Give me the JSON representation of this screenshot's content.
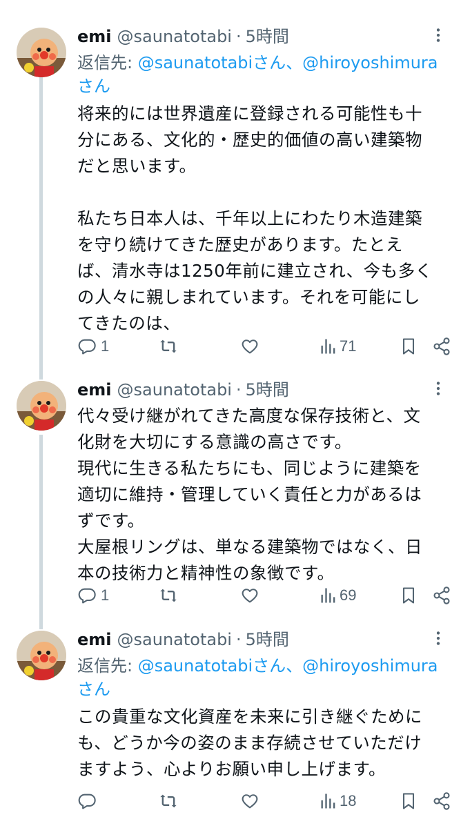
{
  "tweets": [
    {
      "name": "emi",
      "handle": "@saunatotabi",
      "dot": "·",
      "time": "5時間",
      "replying_prefix": "返信先: ",
      "replying_to_1": "@saunatotabiさん",
      "replying_sep": "、",
      "replying_to_2": "@hiroyoshimuraさん",
      "text": "将来的には世界遺産に登録される可能性も十\n分にある、文化的・歴史的価値の高い建築物\nだと思います。\n\n私たち日本人は、千年以上にわたり木造建築\nを守り続けてきた歴史があります。たとえ\nば、清水寺は1250年前に建立され、今も多く\nの人々に親しまれています。それを可能にし\nてきたのは、",
      "replies": "1",
      "views": "71"
    },
    {
      "name": "emi",
      "handle": "@saunatotabi",
      "dot": "·",
      "time": "5時間",
      "text": "代々受け継がれてきた高度な保存技術と、文\n化財を大切にする意識の高さです。\n現代に生きる私たちにも、同じように建築を\n適切に維持・管理していく責任と力があるは\nずです。\n大屋根リングは、単なる建築物ではなく、日\n本の技術力と精神性の象徴です。",
      "replies": "1",
      "views": "69"
    },
    {
      "name": "emi",
      "handle": "@saunatotabi",
      "dot": "·",
      "time": "5時間",
      "replying_prefix": "返信先: ",
      "replying_to_1": "@saunatotabiさん",
      "replying_sep": "、",
      "replying_to_2": "@hiroyoshimuraさん",
      "text": "この貴重な文化資産を未来に引き継ぐために\nも、どうか今の姿のまま存続させていただけ\nますよう、心よりお願い申し上げます。",
      "replies": "",
      "views": "18"
    }
  ],
  "icons": {
    "reply": "reply-icon",
    "retweet": "retweet-icon",
    "like": "heart-icon",
    "views": "views-icon",
    "bookmark": "bookmark-icon",
    "share": "share-icon",
    "more": "more-icon"
  },
  "colors": {
    "text": "#0f1419",
    "secondary": "#536471",
    "link": "#1d9bf0",
    "thread_line": "#cfd9de"
  }
}
